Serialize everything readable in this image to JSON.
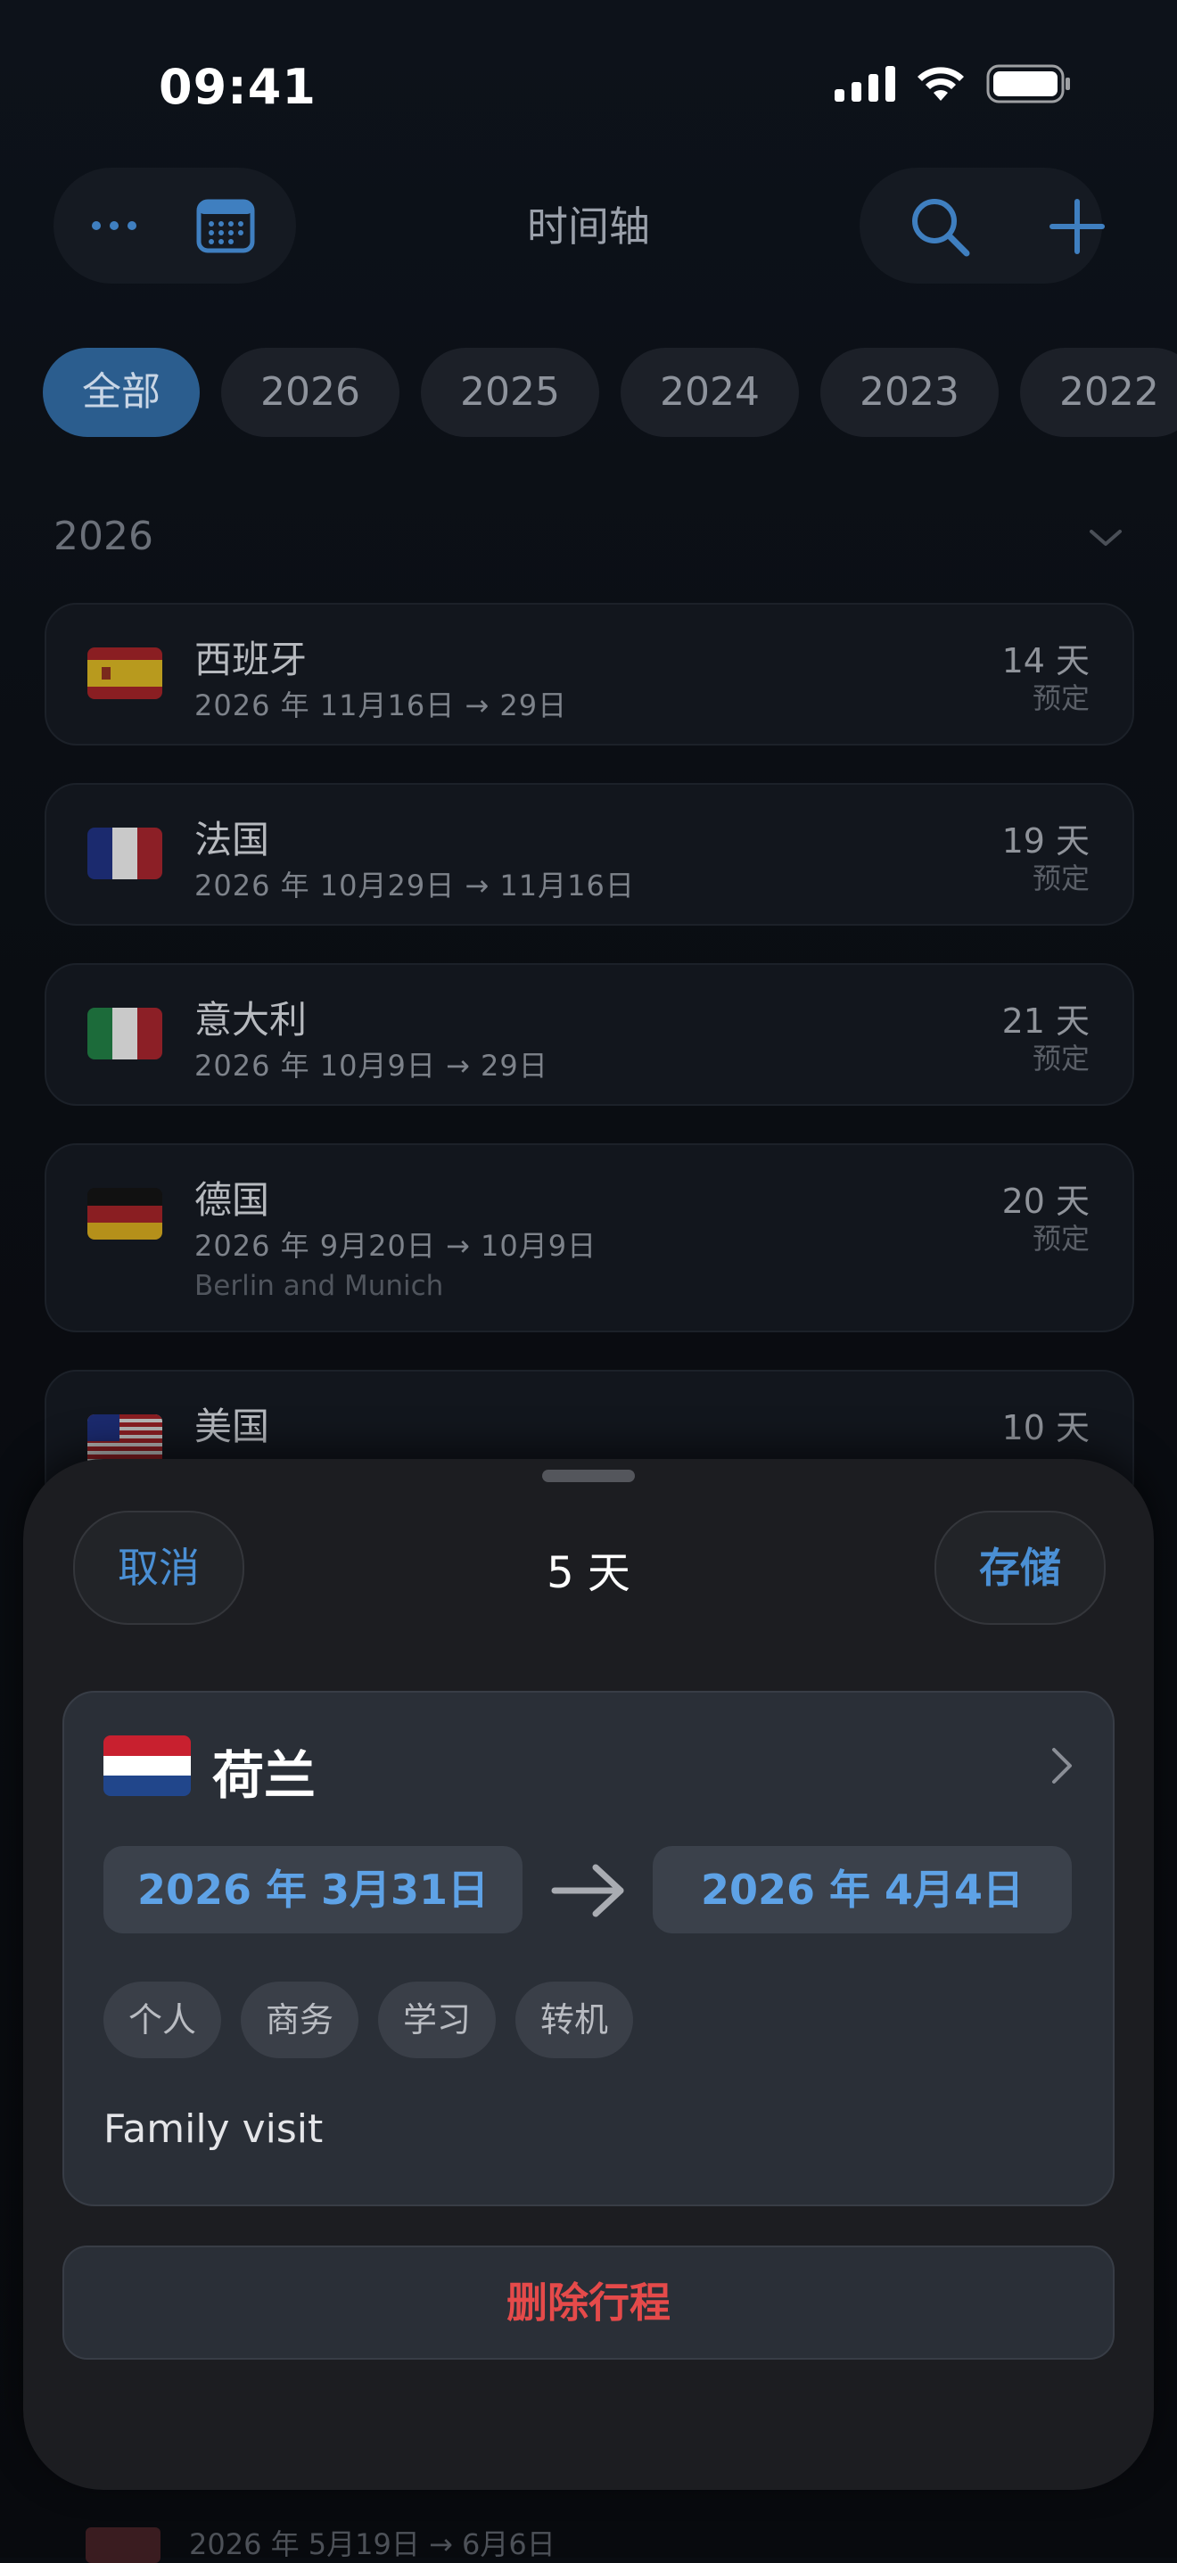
{
  "status_bar": {
    "time": "09:41"
  },
  "header": {
    "title": "时间轴"
  },
  "year_tabs": [
    "全部",
    "2026",
    "2025",
    "2024",
    "2023",
    "2022"
  ],
  "section": {
    "year": "2026"
  },
  "trips": [
    {
      "country": "西班牙",
      "dates": "2026 年 11月16日 → 29日",
      "note": "",
      "days": "14 天",
      "status": "预定"
    },
    {
      "country": "法国",
      "dates": "2026 年 10月29日 → 11月16日",
      "note": "",
      "days": "19 天",
      "status": "预定"
    },
    {
      "country": "意大利",
      "dates": "2026 年 10月9日 → 29日",
      "note": "",
      "days": "21 天",
      "status": "预定"
    },
    {
      "country": "德国",
      "dates": "2026 年 9月20日 → 10月9日",
      "note": "Berlin and Munich",
      "days": "20 天",
      "status": "预定"
    },
    {
      "country": "美国",
      "dates": "",
      "note": "",
      "days": "10 天",
      "status": ""
    }
  ],
  "sheet": {
    "cancel_label": "取消",
    "title": "5 天",
    "save_label": "存储",
    "country": "荷兰",
    "start_date": "2026 年 3月31日",
    "end_date": "2026 年 4月4日",
    "tags": [
      "个人",
      "商务",
      "学习",
      "转机"
    ],
    "note": "Family visit",
    "delete_label": "删除行程"
  },
  "behind_partial_dates": "2026 年 5月19日 → 6月6日",
  "colors": {
    "accent": "#4a8fd4",
    "danger": "#e54a4a",
    "sheet_bg": "#1c1d21"
  }
}
